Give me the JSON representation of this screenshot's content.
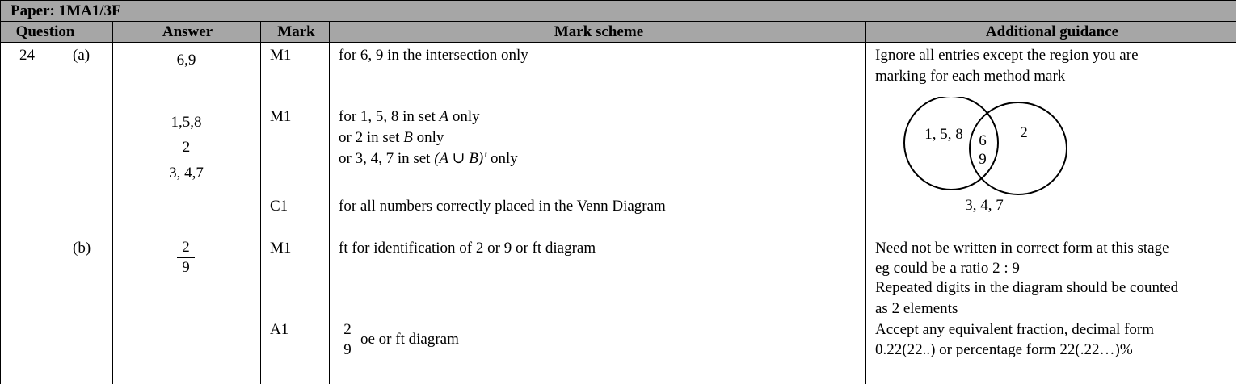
{
  "paper": {
    "label": "Paper: 1MA1/3F"
  },
  "headers": {
    "question": "Question",
    "answer": "Answer",
    "mark": "Mark",
    "scheme": "Mark scheme",
    "guidance": "Additional guidance"
  },
  "rows": {
    "q_number": "24",
    "part_a": "(a)",
    "part_b": "(b)",
    "a_answer_1": "6,9",
    "a_answer_2": "1,5,8",
    "a_answer_3": "2",
    "a_answer_4": "3, 4,7",
    "a_mark_1": "M1",
    "a_mark_2": "M1",
    "a_mark_3": "C1",
    "a_scheme_1": "for 6, 9 in the intersection only",
    "a_scheme_2_prefix": "for 1, 5, 8  in set ",
    "a_scheme_2_set": "A",
    "a_scheme_2_suffix": " only",
    "a_scheme_3_prefix": "or 2 in set ",
    "a_scheme_3_set": "B",
    "a_scheme_3_suffix": " only",
    "a_scheme_4_prefix": "or 3, 4, 7 in set ",
    "a_scheme_4_set": "(A ∪ B)'",
    "a_scheme_4_suffix": " only",
    "a_scheme_5": "for all numbers correctly placed in the Venn Diagram",
    "a_guidance_1": "Ignore all entries except the region you are",
    "a_guidance_2": "marking for each method mark",
    "b_answer_num": "2",
    "b_answer_den": "9",
    "b_mark_1": "M1",
    "b_mark_2": "A1",
    "b_scheme_1": "ft for identification of 2 or 9 or ft diagram",
    "b_scheme_2_num": "2",
    "b_scheme_2_den": "9",
    "b_scheme_2_text": "oe or ft diagram",
    "b_guidance_1": "Need not be written in correct form at this stage",
    "b_guidance_2": "eg could be a ratio 2 : 9",
    "b_guidance_3": "Repeated digits in the diagram should be counted",
    "b_guidance_4": "as 2 elements",
    "b_guidance_5": "Accept any equivalent fraction, decimal form",
    "b_guidance_6": "0.22(22..) or percentage form 22(.22…)%"
  },
  "venn": {
    "set_a_only": "1, 5, 8",
    "intersection_top": "6",
    "intersection_bottom": "9",
    "set_b_only": "2",
    "outside": "3, 4, 7"
  }
}
